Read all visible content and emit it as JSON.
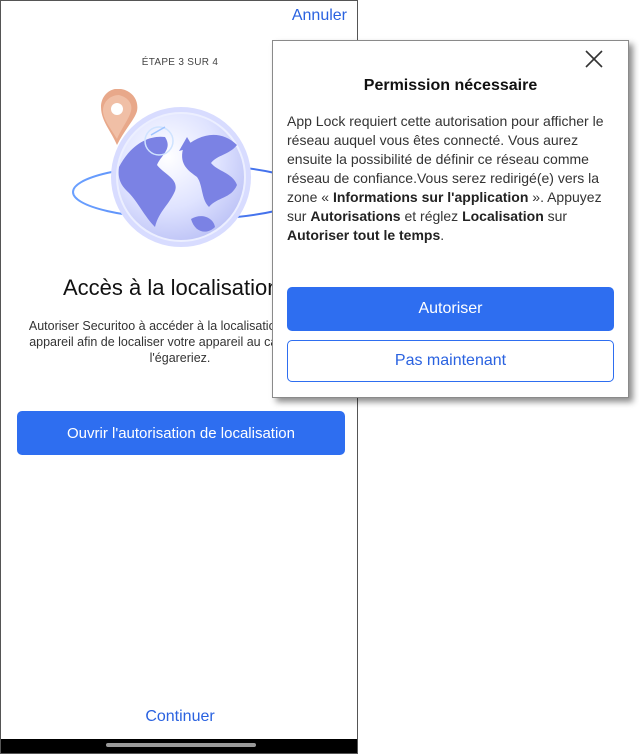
{
  "screen": {
    "cancel_label": "Annuler",
    "step_label": "ÉTAPE 3 SUR 4",
    "illustration_icon": "globe-with-location-pin-icon",
    "headline": "Accès à la localisation",
    "description": "Autoriser Securitoo à accéder à la localisation de votre appareil afin de localiser votre appareil au cas où vous l'égareriez.",
    "primary_button": "Ouvrir l'autorisation de localisation",
    "continue_label": "Continuer"
  },
  "dialog": {
    "close_icon": "close-icon",
    "title": "Permission nécessaire",
    "body": {
      "p1": "App Lock requiert cette autorisation pour afficher le réseau auquel vous êtes connecté. Vous aurez ensuite la possibilité de définir ce réseau comme réseau de confiance.Vous serez redirigé(e) vers la zone « ",
      "b1": "Informations sur l'application",
      "p2": " ». Appuyez sur ",
      "b2": "Autorisations",
      "p3": " et réglez ",
      "b3": "Localisation",
      "p4": " sur ",
      "b4": "Autoriser tout le temps",
      "p5": "."
    },
    "allow_button": "Autoriser",
    "later_button": "Pas maintenant"
  },
  "colors": {
    "accent": "#2e6ef0",
    "link": "#2a62e0",
    "pin": "#e8a88a",
    "globe": "#7b82e4"
  }
}
